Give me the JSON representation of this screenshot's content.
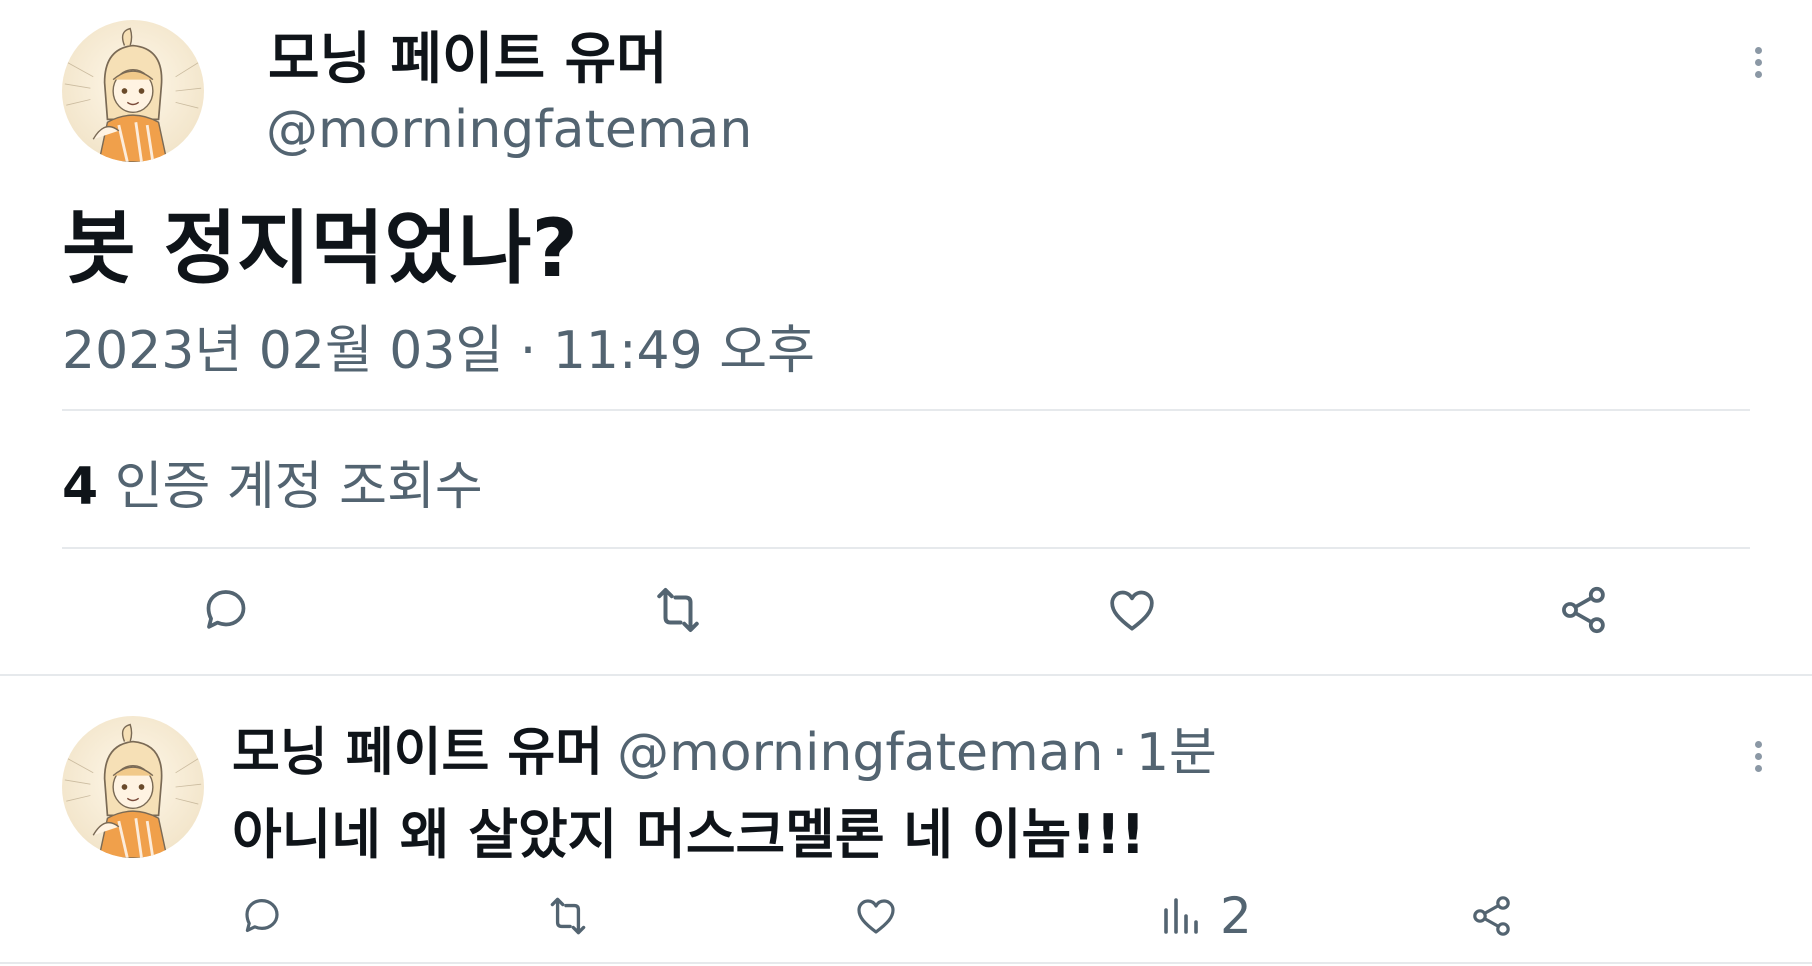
{
  "main_tweet": {
    "display_name": "모닝 페이트 유머",
    "handle": "@morningfateman",
    "text": "봇 정지먹었나?",
    "timestamp": "2023년 02월 03일 · 11:49 오후",
    "views_count": "4",
    "views_label": "인증 계정 조회수",
    "actions": [
      "reply-icon",
      "retweet-icon",
      "like-icon",
      "share-icon"
    ]
  },
  "reply_tweet": {
    "display_name": "모닝 페이트 유머",
    "handle": "@morningfateman",
    "separator": "·",
    "time": "1분",
    "text": "아니네 왜 살았지 머스크멜론 네 이놈!!!",
    "views_count": "2",
    "actions": [
      "reply-icon",
      "retweet-icon",
      "like-icon",
      "views-icon",
      "share-icon"
    ]
  },
  "colors": {
    "text_primary": "#0f1419",
    "text_secondary": "#536471",
    "divider": "#e6e9ec",
    "avatar_accent": "#f0a04b"
  }
}
